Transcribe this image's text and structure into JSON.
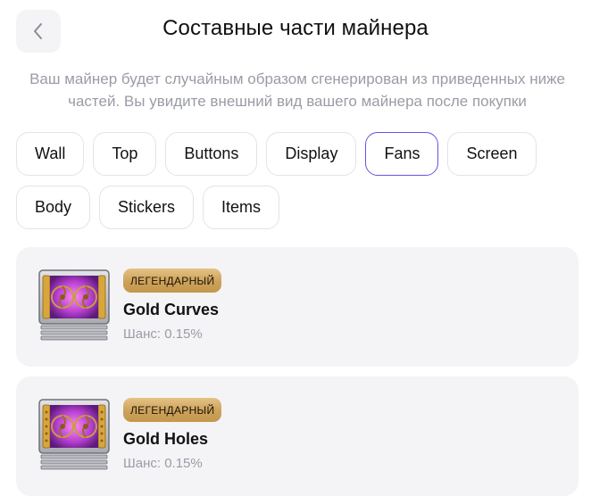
{
  "header": {
    "title": "Составные части майнера",
    "back_icon": "chevron-left-icon"
  },
  "description": "Ваш майнер будет случайным образом сгенерирован из приведенных ниже частей. Вы увидите внешний вид вашего майнера после покупки",
  "tabs": [
    {
      "label": "Wall",
      "active": false
    },
    {
      "label": "Top",
      "active": false
    },
    {
      "label": "Buttons",
      "active": false
    },
    {
      "label": "Display",
      "active": false
    },
    {
      "label": "Fans",
      "active": true
    },
    {
      "label": "Screen",
      "active": false
    },
    {
      "label": "Body",
      "active": false
    },
    {
      "label": "Stickers",
      "active": false
    },
    {
      "label": "Items",
      "active": false
    }
  ],
  "items": [
    {
      "rarity": "ЛЕГЕНДАРНЫЙ",
      "name": "Gold Curves",
      "chance": "Шанс: 0.15%",
      "image": "gold-curves-fans-icon"
    },
    {
      "rarity": "ЛЕГЕНДАРНЫЙ",
      "name": "Gold Holes",
      "chance": "Шанс: 0.15%",
      "image": "gold-holes-fans-icon"
    }
  ],
  "colors": {
    "accent": "#6d4fe3",
    "badge_gold": "#d2a862",
    "card_bg": "#f4f4f6",
    "muted_text": "#9a9ca6"
  }
}
